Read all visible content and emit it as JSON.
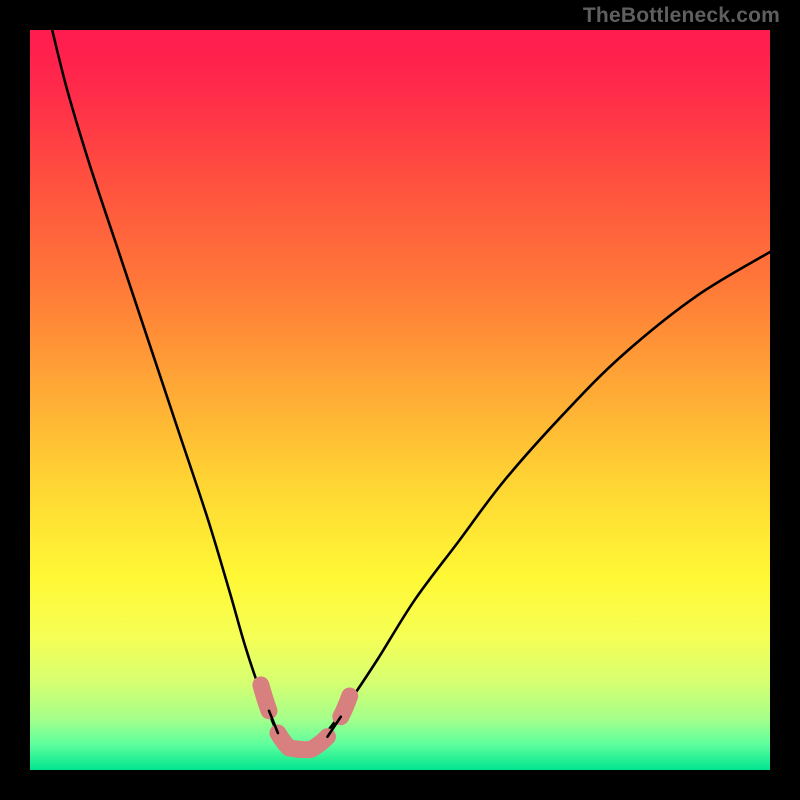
{
  "watermark": "TheBottleneck.com",
  "chart_data": {
    "type": "line",
    "title": "",
    "xlabel": "",
    "ylabel": "",
    "xlim": [
      0,
      100
    ],
    "ylim": [
      0,
      100
    ],
    "series": [
      {
        "name": "bottleneck-curve",
        "x": [
          3,
          5,
          8,
          12,
          16,
          20,
          24,
          27,
          29,
          31,
          33,
          34.5,
          36,
          38,
          40,
          43,
          47,
          52,
          58,
          64,
          72,
          80,
          90,
          100
        ],
        "y": [
          100,
          92,
          82,
          70,
          58,
          46,
          34,
          24,
          17,
          11,
          6,
          3,
          2.5,
          3,
          5,
          9,
          15,
          23,
          31,
          39,
          48,
          56,
          64,
          70
        ]
      }
    ],
    "highlight_band": {
      "name": "optimal-range",
      "path_segments": [
        {
          "x1": 31.2,
          "y1": 11.5,
          "x2": 32.3,
          "y2": 8,
          "occluded_mid": true
        },
        {
          "x1": 33.5,
          "y1": 5,
          "x2": 35,
          "y2": 3
        },
        {
          "x1": 35,
          "y1": 3,
          "x2": 38,
          "y2": 2.8
        },
        {
          "x1": 38,
          "y1": 2.8,
          "x2": 40.2,
          "y2": 4.5
        },
        {
          "x1": 42,
          "y1": 7.2,
          "x2": 43.2,
          "y2": 10,
          "occluded_start": true
        }
      ],
      "color": "#d88080"
    },
    "background_gradient": {
      "stops": [
        {
          "offset": 0.0,
          "color": "#ff1b4f"
        },
        {
          "offset": 0.08,
          "color": "#ff2a4a"
        },
        {
          "offset": 0.2,
          "color": "#ff4f3f"
        },
        {
          "offset": 0.35,
          "color": "#ff7a38"
        },
        {
          "offset": 0.5,
          "color": "#ffae35"
        },
        {
          "offset": 0.62,
          "color": "#ffd733"
        },
        {
          "offset": 0.74,
          "color": "#fff835"
        },
        {
          "offset": 0.82,
          "color": "#f6ff55"
        },
        {
          "offset": 0.88,
          "color": "#d7ff70"
        },
        {
          "offset": 0.93,
          "color": "#a6ff8a"
        },
        {
          "offset": 0.965,
          "color": "#5fff9e"
        },
        {
          "offset": 1.0,
          "color": "#00e58f"
        }
      ]
    }
  }
}
